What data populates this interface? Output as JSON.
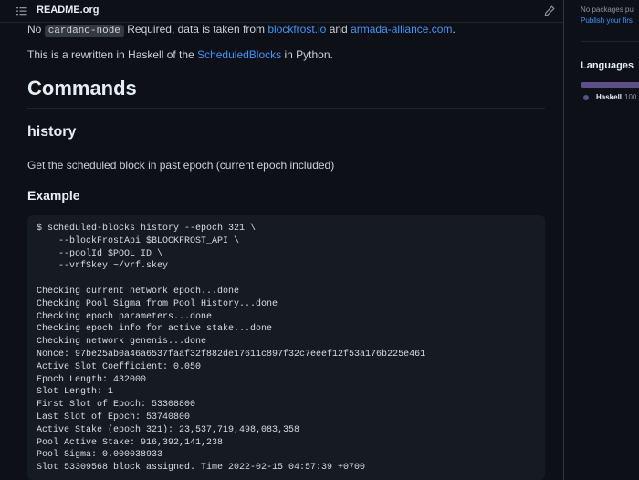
{
  "readme": {
    "title": "README.org"
  },
  "content": {
    "p1_prefix": "No ",
    "p1_code": "cardano-node",
    "p1_mid": " Required, data is taken from ",
    "p1_link1": "blockfrost.io",
    "p1_and": " and ",
    "p1_link2": "armada-alliance.com",
    "p1_end": ".",
    "p2_prefix": "This is a rewritten in Haskell of the ",
    "p2_link": "ScheduledBlocks",
    "p2_suffix": " in Python.",
    "h1": "Commands",
    "h2": "history",
    "p3": "Get the scheduled block in past epoch (current epoch included)",
    "h3": "Example"
  },
  "code_lines": [
    "$ scheduled-blocks history --epoch 321 \\",
    "    --blockFrostApi $BLOCKFROST_API \\",
    "    --poolId $POOL_ID \\",
    "    --vrfSkey ~/vrf.skey",
    "",
    "Checking current network epoch...done",
    "Checking Pool Sigma from Pool History...done",
    "Checking epoch parameters...done",
    "Checking epoch info for active stake...done",
    "Checking network genenis...done",
    "Nonce: 97be25ab0a46a6537faaf32f882de17611c897f32c7eeef12f53a176b225e461",
    "Active Slot Coefficient: 0.050",
    "Epoch Length: 432000",
    "Slot Length: 1",
    "First Slot of Epoch: 53308800",
    "Last Slot of Epoch: 53740800",
    "Active Stake (epoch 321): 23,537,719,498,083,358",
    "Pool Active Stake: 916,392,141,238",
    "Pool Sigma: 0.000038933",
    "Slot 53309568 block assigned. Time 2022-02-15 04:57:39 +0700"
  ],
  "sidebar": {
    "packages_text": "No packages pu",
    "publish_link": "Publish your firs",
    "languages_title": "Languages",
    "language_name": "Haskell",
    "language_pct": "100",
    "language_color": "#5e5086"
  }
}
